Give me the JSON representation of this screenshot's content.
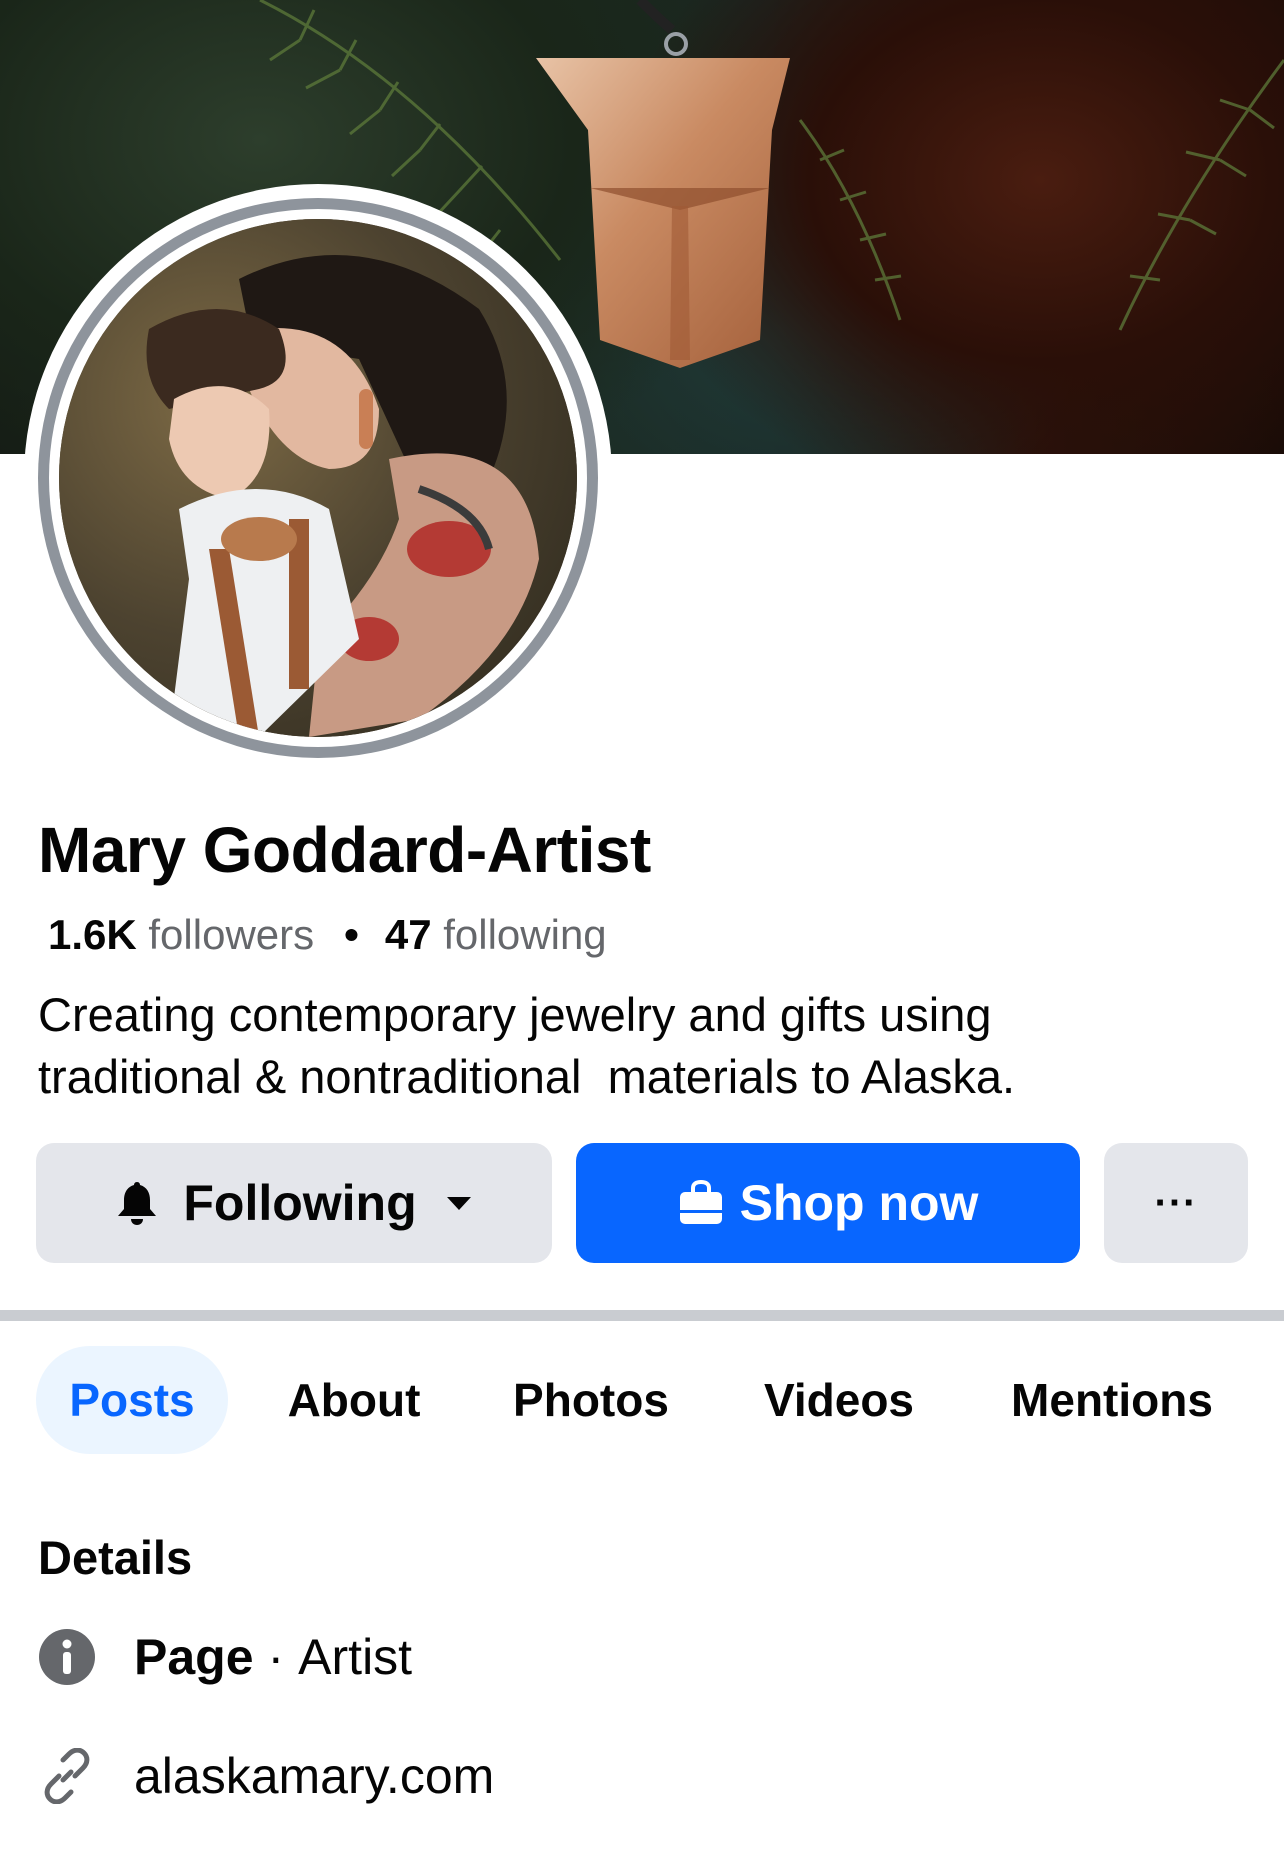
{
  "profile": {
    "name": "Mary Goddard-Artist",
    "followers_count": "1.6K",
    "followers_label": "followers",
    "following_count": "47",
    "following_label": "following",
    "bio": "Creating contemporary jewelry and gifts using\ntraditional & nontraditional  materials to Alaska."
  },
  "actions": {
    "following_label": "Following",
    "shop_label": "Shop now",
    "more_label": "···"
  },
  "tabs": [
    {
      "label": "Posts",
      "active": true
    },
    {
      "label": "About",
      "active": false
    },
    {
      "label": "Photos",
      "active": false
    },
    {
      "label": "Videos",
      "active": false
    },
    {
      "label": "Mentions",
      "active": false
    }
  ],
  "details": {
    "title": "Details",
    "category_prefix": "Page",
    "category_separator": "·",
    "category": "Artist",
    "website": "alaskamary.com"
  },
  "colors": {
    "accent_blue": "#0866ff",
    "button_gray": "#e4e6eb",
    "active_tab_bg": "#ebf5ff",
    "secondary_text": "#65676b"
  },
  "icons": {
    "following_button": "bell-icon",
    "following_dropdown": "caret-down-icon",
    "shop_button": "shopping-bag-icon",
    "more_button": "more-dots-icon",
    "category": "info-icon",
    "website": "link-icon"
  }
}
